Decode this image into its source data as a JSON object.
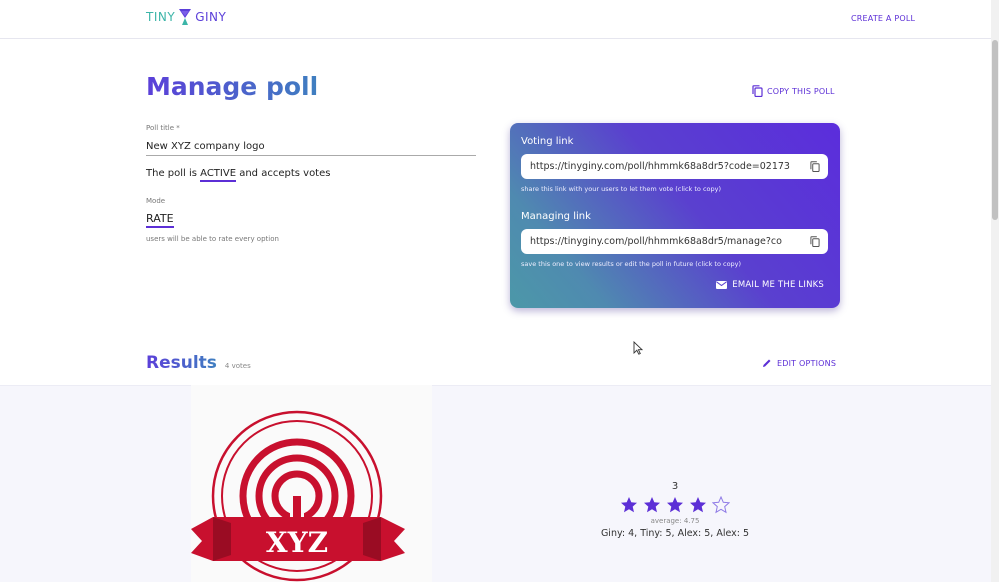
{
  "header": {
    "logo_left": "TINY",
    "logo_right": "GINY",
    "create_poll": "CREATE A POLL"
  },
  "page": {
    "title": "Manage poll",
    "copy_poll": "COPY THIS POLL"
  },
  "form": {
    "title_label": "Poll title *",
    "title_value": "New XYZ company logo",
    "status_prefix": "The poll is",
    "status_value": "ACTIVE",
    "status_suffix": "and accepts votes",
    "mode_label": "Mode",
    "mode_value": "RATE",
    "mode_help": "users will be able to rate every option"
  },
  "links": {
    "voting_label": "Voting link",
    "voting_url": "https://tinyginy.com/poll/hhmmk68a8dr5?code=02173",
    "voting_hint": "share this link with your users to let them vote (click to copy)",
    "managing_label": "Managing link",
    "managing_url": "https://tinyginy.com/poll/hhmmk68a8dr5/manage?co",
    "managing_hint": "save this one to view results or edit the poll in future (click to copy)",
    "email_button": "EMAIL ME THE LINKS"
  },
  "results": {
    "title": "Results",
    "count": "4 votes",
    "edit_options": "EDIT OPTIONS",
    "options": [
      {
        "image_text": "XYZ",
        "rating": "3",
        "stars_filled": 4,
        "stars_total": 5,
        "average": "average: 4.75",
        "votes": "Giny: 4, Tiny: 5, Alex: 5, Alex: 5"
      }
    ]
  },
  "colors": {
    "accent": "#5c2fd6",
    "teal": "#3cb5a8",
    "logo_red": "#c8102e"
  }
}
